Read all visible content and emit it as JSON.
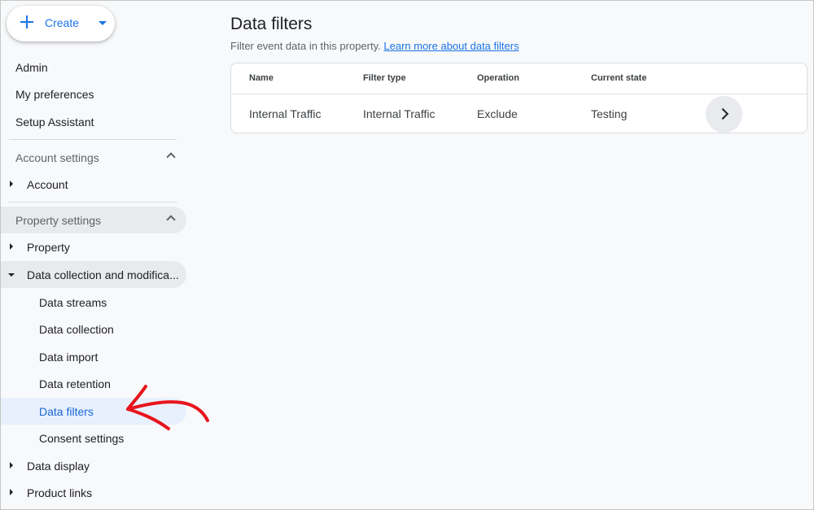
{
  "sidebar": {
    "create_label": "Create",
    "top_items": [
      "Admin",
      "My preferences",
      "Setup Assistant"
    ],
    "account_settings": {
      "label": "Account settings",
      "items": [
        "Account"
      ]
    },
    "property_settings": {
      "label": "Property settings",
      "property": "Property",
      "data_collection": "Data collection and modifica...",
      "sub_items": [
        "Data streams",
        "Data collection",
        "Data import",
        "Data retention",
        "Data filters",
        "Consent settings"
      ],
      "data_display": "Data display",
      "product_links": "Product links"
    },
    "selected_item": "Data filters"
  },
  "main": {
    "title": "Data filters",
    "subtitle": "Filter event data in this property.",
    "learn_more": "Learn more about data filters",
    "table": {
      "headers": [
        "Name",
        "Filter type",
        "Operation",
        "Current state"
      ],
      "rows": [
        {
          "name": "Internal Traffic",
          "filter_type": "Internal Traffic",
          "operation": "Exclude",
          "state": "Testing"
        }
      ]
    }
  },
  "colors": {
    "accent": "#1a73e8",
    "selected_bg": "#e8f0fe",
    "annotation_arrow": "#e8141c"
  },
  "icons": [
    "plus-icon",
    "dropdown-caret-icon",
    "chevron-up-icon",
    "expand-arrow-icon",
    "collapse-arrow-icon",
    "chevron-right-icon"
  ]
}
